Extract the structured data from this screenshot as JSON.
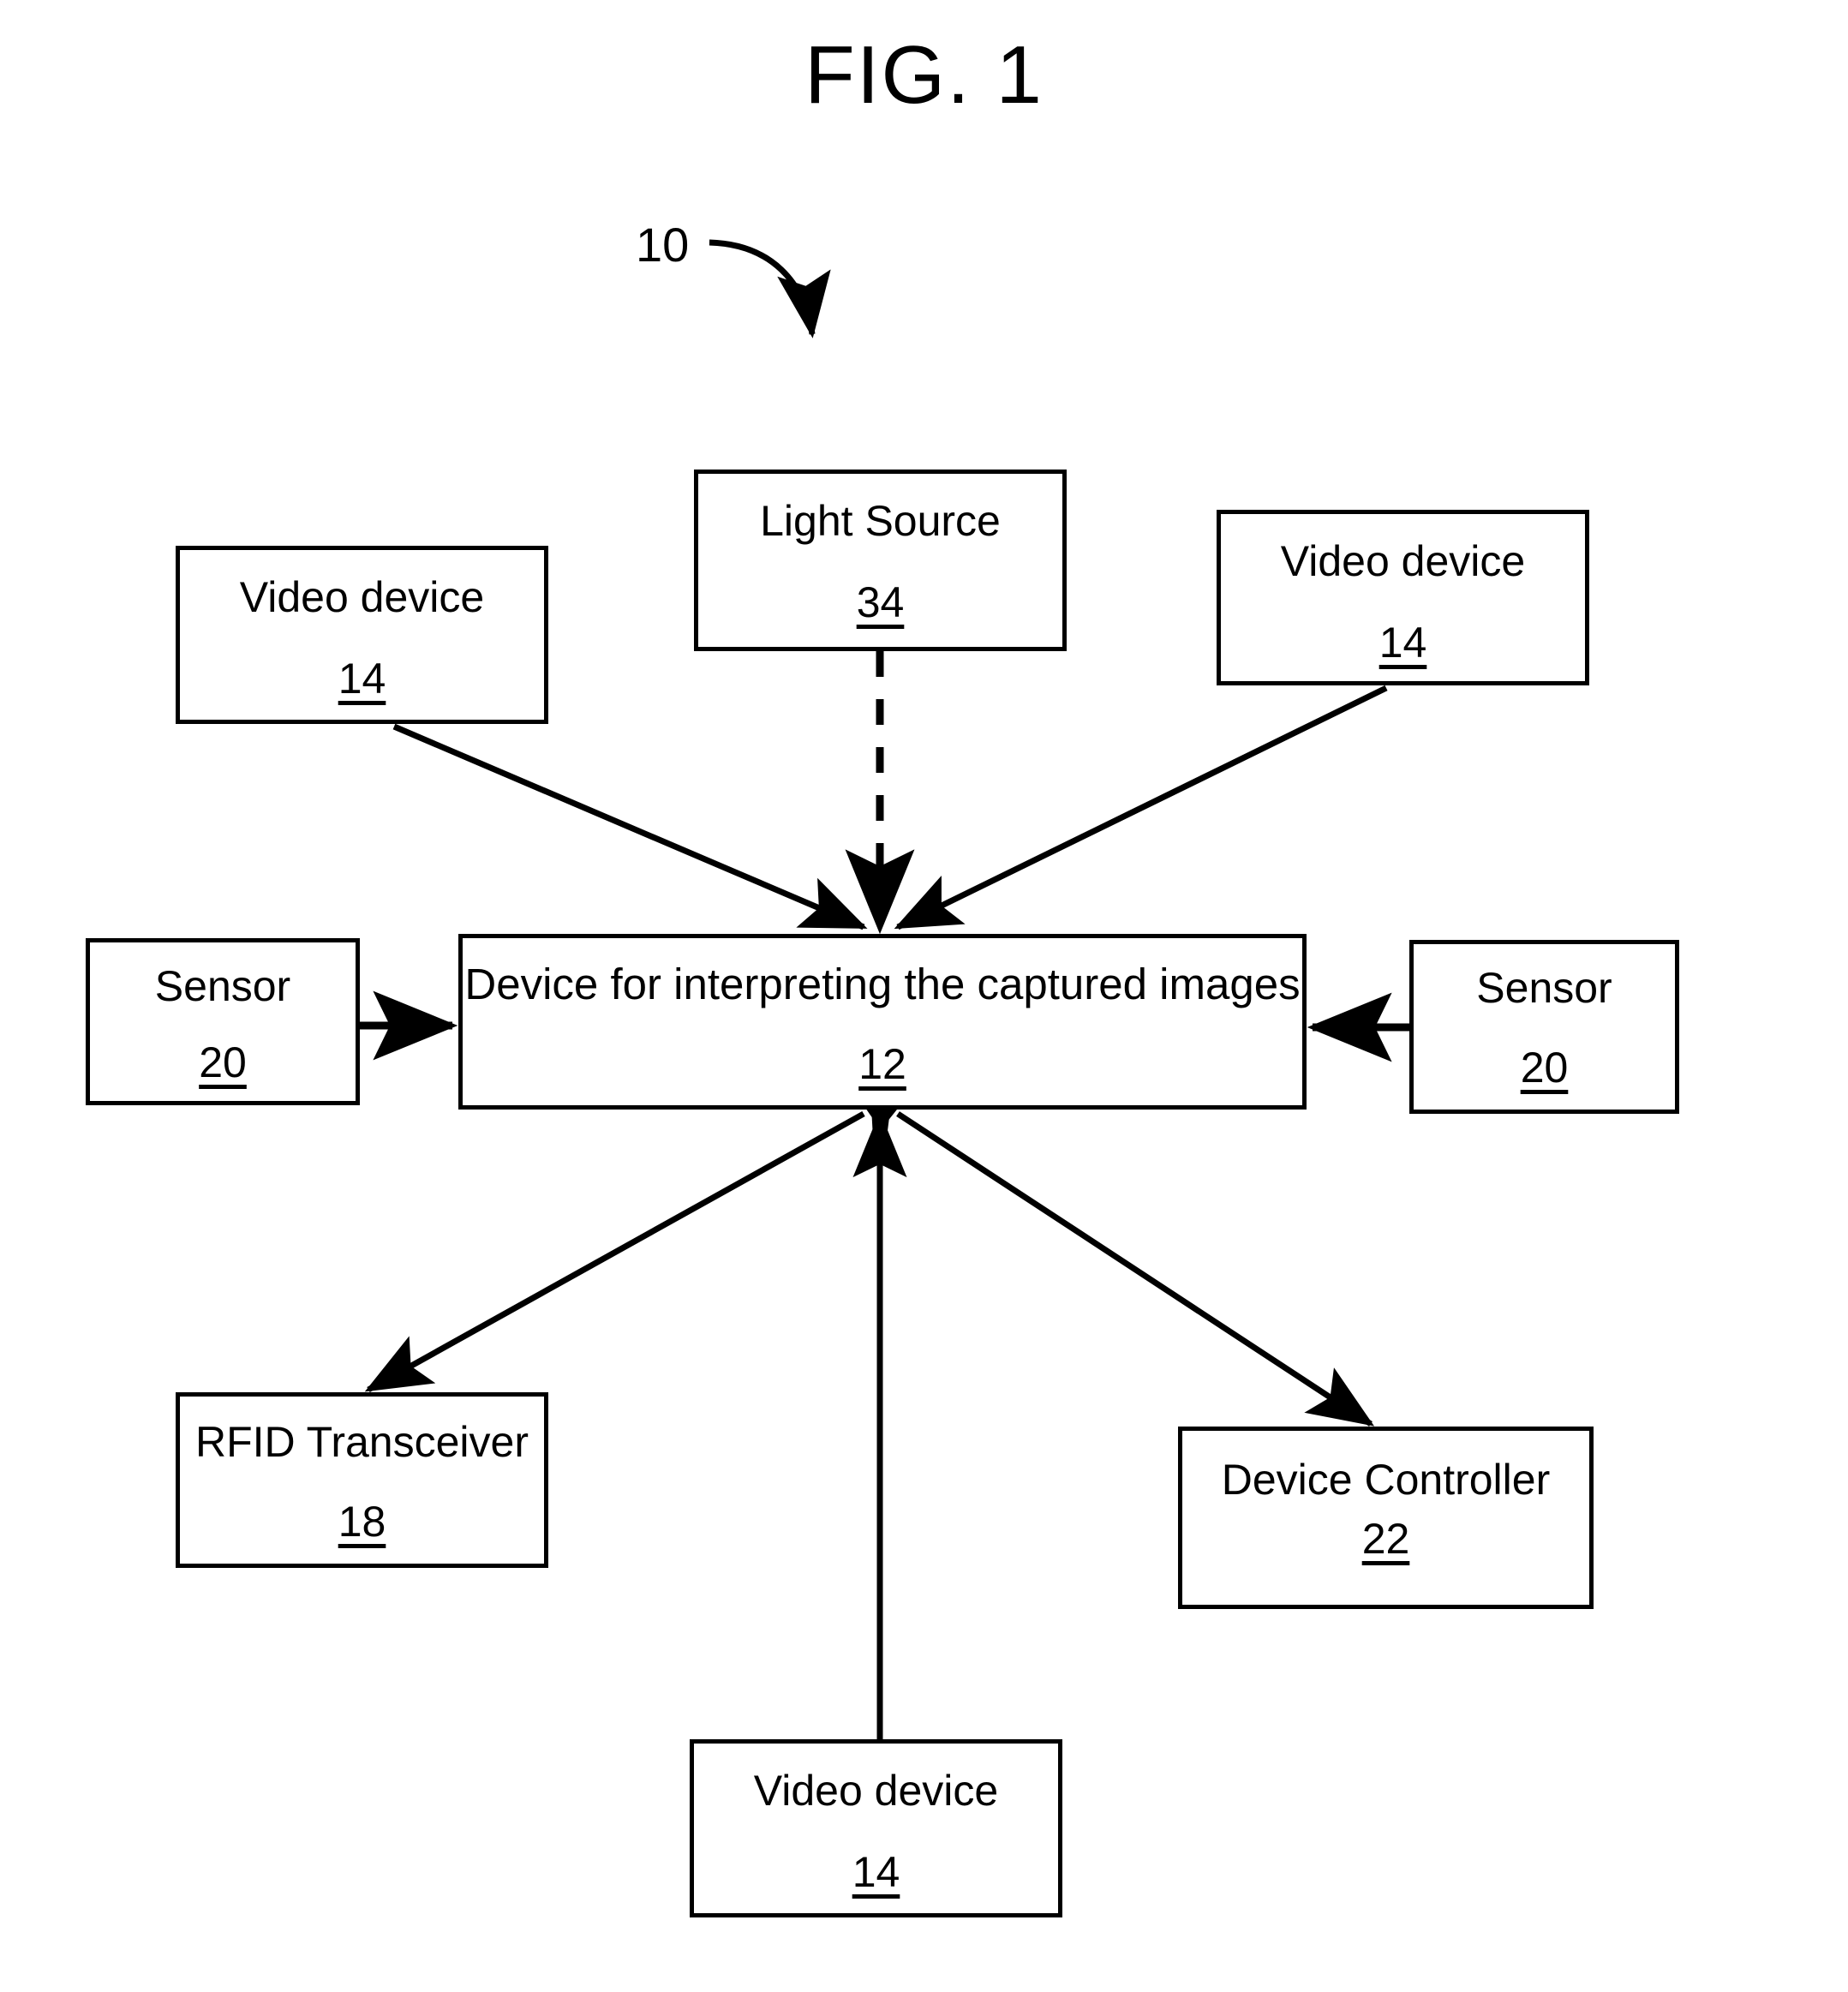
{
  "figure": {
    "title": "FIG. 1",
    "system_reference": "10"
  },
  "nodes": [
    {
      "id": "light-source",
      "title": "Light Source",
      "ref": "34"
    },
    {
      "id": "video-device-top-left",
      "title": "Video device",
      "ref": "14"
    },
    {
      "id": "video-device-top-right",
      "title": "Video device",
      "ref": "14"
    },
    {
      "id": "interpreter",
      "title": "Device for interpreting the captured images",
      "ref": "12"
    },
    {
      "id": "sensor-left",
      "title": "Sensor",
      "ref": "20"
    },
    {
      "id": "sensor-right",
      "title": "Sensor",
      "ref": "20"
    },
    {
      "id": "rfid-transceiver",
      "title": "RFID Transceiver",
      "ref": "18"
    },
    {
      "id": "device-controller",
      "title": "Device Controller",
      "ref": "22"
    },
    {
      "id": "video-device-bottom",
      "title": "Video device",
      "ref": "14"
    }
  ],
  "connectors": [
    {
      "id": "light-source-to-interpreter",
      "from": "light-source",
      "to": "interpreter",
      "style": "dashed",
      "heads": "single"
    },
    {
      "id": "video-top-left-to-interpreter",
      "from": "video-device-top-left",
      "to": "interpreter",
      "style": "solid",
      "heads": "single"
    },
    {
      "id": "video-top-right-to-interpreter",
      "from": "video-device-top-right",
      "to": "interpreter",
      "style": "solid",
      "heads": "single"
    },
    {
      "id": "sensor-left-to-interpreter",
      "from": "sensor-left",
      "to": "interpreter",
      "style": "solid",
      "heads": "single"
    },
    {
      "id": "sensor-right-to-interpreter",
      "from": "sensor-right",
      "to": "interpreter",
      "style": "solid",
      "heads": "single"
    },
    {
      "id": "interpreter-to-rfid",
      "from": "interpreter",
      "to": "rfid-transceiver",
      "style": "solid",
      "heads": "double"
    },
    {
      "id": "interpreter-to-device-controller",
      "from": "interpreter",
      "to": "device-controller",
      "style": "solid",
      "heads": "double"
    },
    {
      "id": "video-bottom-to-interpreter",
      "from": "video-device-bottom",
      "to": "interpreter",
      "style": "solid",
      "heads": "single"
    },
    {
      "id": "system-pointer",
      "from": "system-reference-label",
      "to": "diagram",
      "style": "curved",
      "heads": "single"
    }
  ],
  "colors": {
    "stroke": "#000000",
    "background": "#ffffff"
  }
}
